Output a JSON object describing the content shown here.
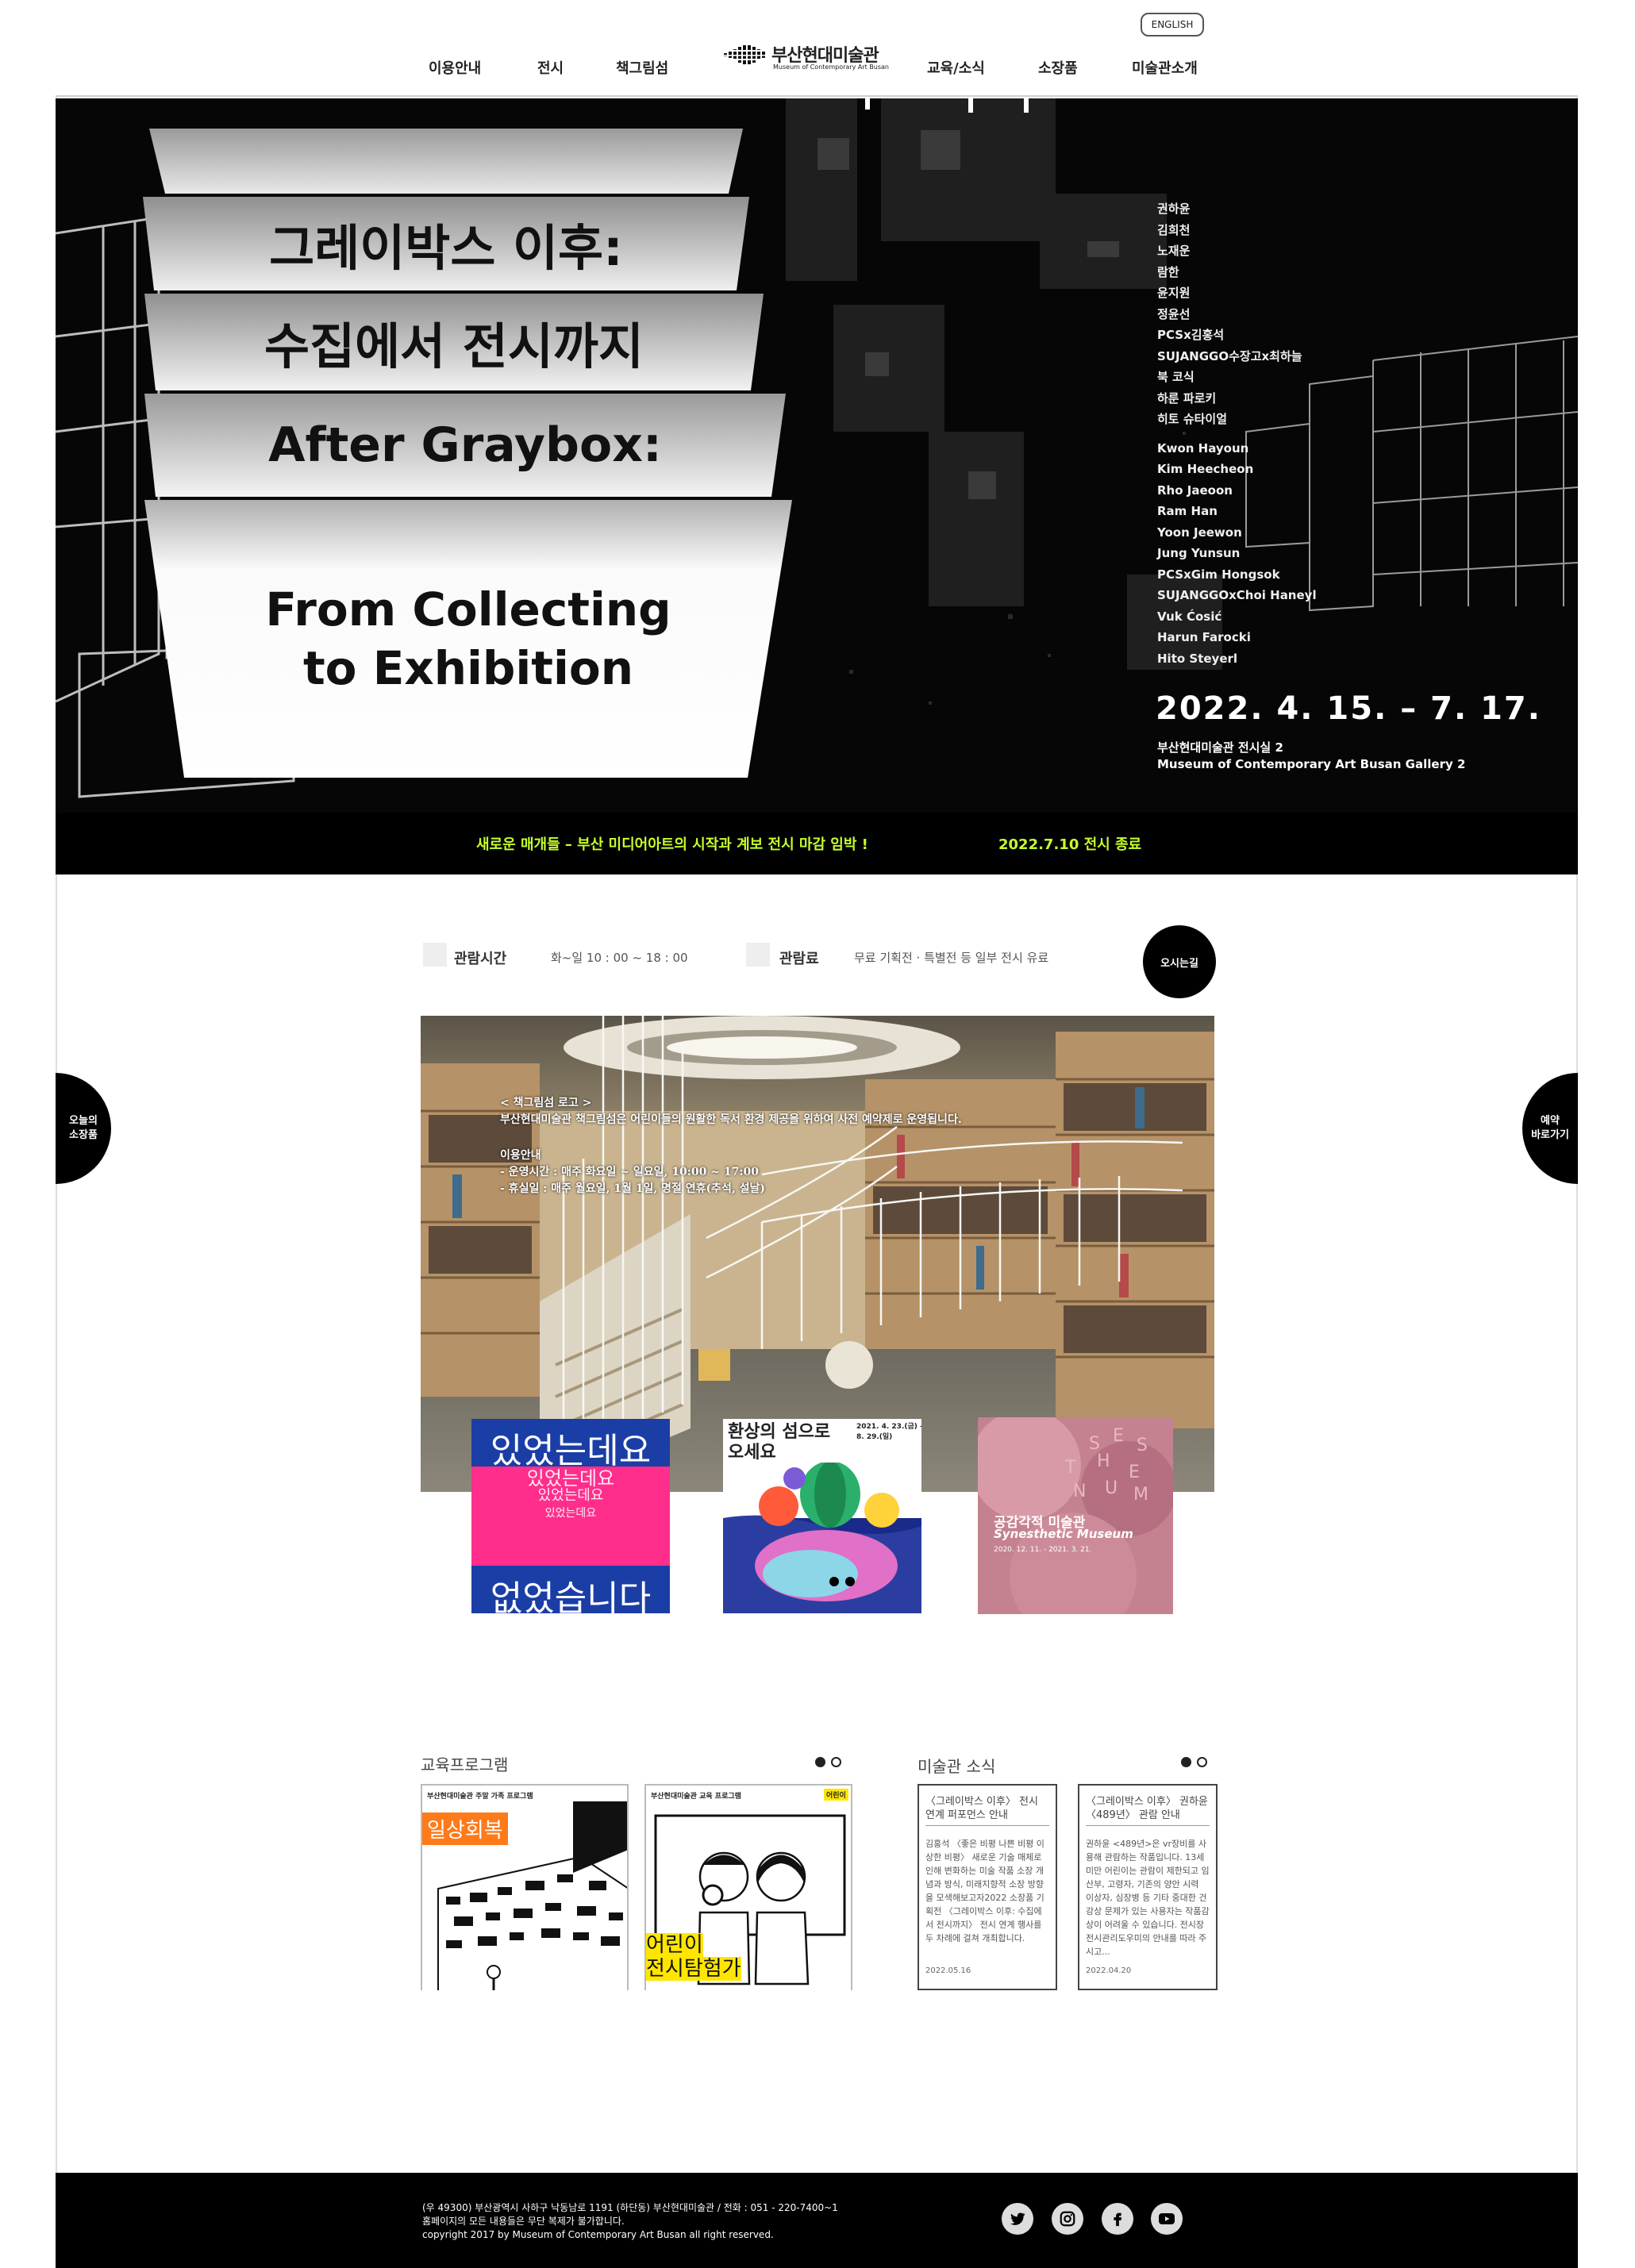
{
  "header": {
    "lang_button": "ENGLISH",
    "nav_left": [
      "이용안내",
      "전시",
      "책그림섬"
    ],
    "nav_right": [
      "교육/소식",
      "소장품",
      "미술관소개"
    ],
    "logo_kr": "부산현대미술관",
    "logo_en": "Museum of Contemporary Art Busan"
  },
  "hero": {
    "title_lines": [
      "그레이박스 이후:",
      "수집에서 전시까지",
      "After Graybox:",
      "From Collecting to Exhibition"
    ],
    "artists_kr": [
      "권하윤",
      "김희천",
      "노재운",
      "람한",
      "윤지원",
      "정윤선",
      "PCSx김홍석",
      "SUJANGGO수장고x최하늘",
      "북 코식",
      "하룬 파로키",
      "히토 슈타이얼"
    ],
    "artists_en": [
      "Kwon Hayoun",
      "Kim Heecheon",
      "Rho Jaeoon",
      "Ram Han",
      "Yoon Jeewon",
      "Jung Yunsun",
      "PCSxGim Hongsok",
      "SUJANGGOxChoi Haneyl",
      "Vuk Ćosić",
      "Harun Farocki",
      "Hito Steyerl"
    ],
    "date": "2022. 4. 15. – 7. 17.",
    "place_kr": "부산현대미술관 전시실 2",
    "place_en": "Museum of Contemporary Art Busan Gallery 2"
  },
  "notice": {
    "text": "새로운 매개들 – 부산 미디어아트의 시작과 계보 전시 마감 임박 !",
    "end": "2022.7.10 전시 종료"
  },
  "info": {
    "hours_label": "관람시간",
    "hours_value": "화~일   10 : 00 ~ 18 : 00",
    "fee_label": "관람료",
    "fee_value": "무료   기획전 · 특별전 등 일부 전시 유료",
    "directions_button": "오시는길"
  },
  "side": {
    "left": "오늘의\n소장품",
    "right": "예약\n바로가기"
  },
  "library": {
    "heading": "< 책그림섬 로고 >",
    "line1": "부산현대미술관 책그림섬은 어린이들의 원활한 독서 환경 제공을 위하여 사전 예약제로 운영됩니다.",
    "guide_title": "이용안내",
    "guide_hours": "- 운영시간 : 매주 화요일 ~ 일요일, 10:00 ~ 17:00",
    "guide_closed": "- 휴실일 : 매주 월요일, 1월 1일, 명절 연휴(추석, 설날)"
  },
  "posters": {
    "p1_main": "있었는데요",
    "p1_bottom": "없었습니다",
    "p2_title": "환상의 섬으로\n오세요",
    "p2_date": "2021. 4. 23.(금) —\n8. 29.(일)",
    "p3_kr": "공감각적 미술관",
    "p3_en": "Synesthetic Museum",
    "p3_date": "2020. 12. 11. - 2021. 3. 21."
  },
  "edu": {
    "title": "교육프로그램",
    "cards": [
      {
        "header": "부산현대미술관 주말 가족 프로그램",
        "label": "일상회복"
      },
      {
        "header": "부산현대미술관 교육 프로그램",
        "tag": "어린이",
        "label": "어린이\n전시탐험가"
      }
    ]
  },
  "news": {
    "title": "미술관 소식",
    "items": [
      {
        "title": "〈그레이박스 이후〉 전시 연계 퍼포먼스 안내",
        "body": "김홍석 〈좋은 비평 나쁜 비평 이상한 비평〉 새로운 기술 매체로 인해 변화하는 미술 작품 소장 개념과 방식, 미래지향적 소장 방향을 모색해보고자2022 소장품 기획전 〈그레이박스 이후: 수집에서 전시까지〉 전시 연계 행사를 두 차례에 걸쳐 개최합니다.",
        "date": "2022.05.16"
      },
      {
        "title": "〈그레이박스 이후〉 권하윤 〈489년〉 관람 안내",
        "body": "권하윤 <489년>은 vr장비를 사용해 관람하는 작품입니다. 13세 미만 어린이는 관람이 제한되고 임산부, 고령자, 기존의 양안 시력 이상자, 심장병 등 기타 중대한 건강상 문제가 있는 사용자는 작품감상이 어려울 수 있습니다. 전시장 전시관리도우미의 안내를 따라 주시고...",
        "date": "2022.04.20"
      }
    ]
  },
  "footer": {
    "line1": "(우 49300) 부산광역시 사하구 낙동남로 1191 (하단동) 부산현대미술관 / 전화 : 051 - 220-7400~1",
    "line2": "홈페이지의 모든 내용들은 무단 복제가 불가합니다.",
    "line3": "copyright 2017 by Museum of Contemporary Art Busan all right reserved.",
    "social": [
      "twitter-icon",
      "instagram-icon",
      "facebook-icon",
      "youtube-icon"
    ]
  }
}
